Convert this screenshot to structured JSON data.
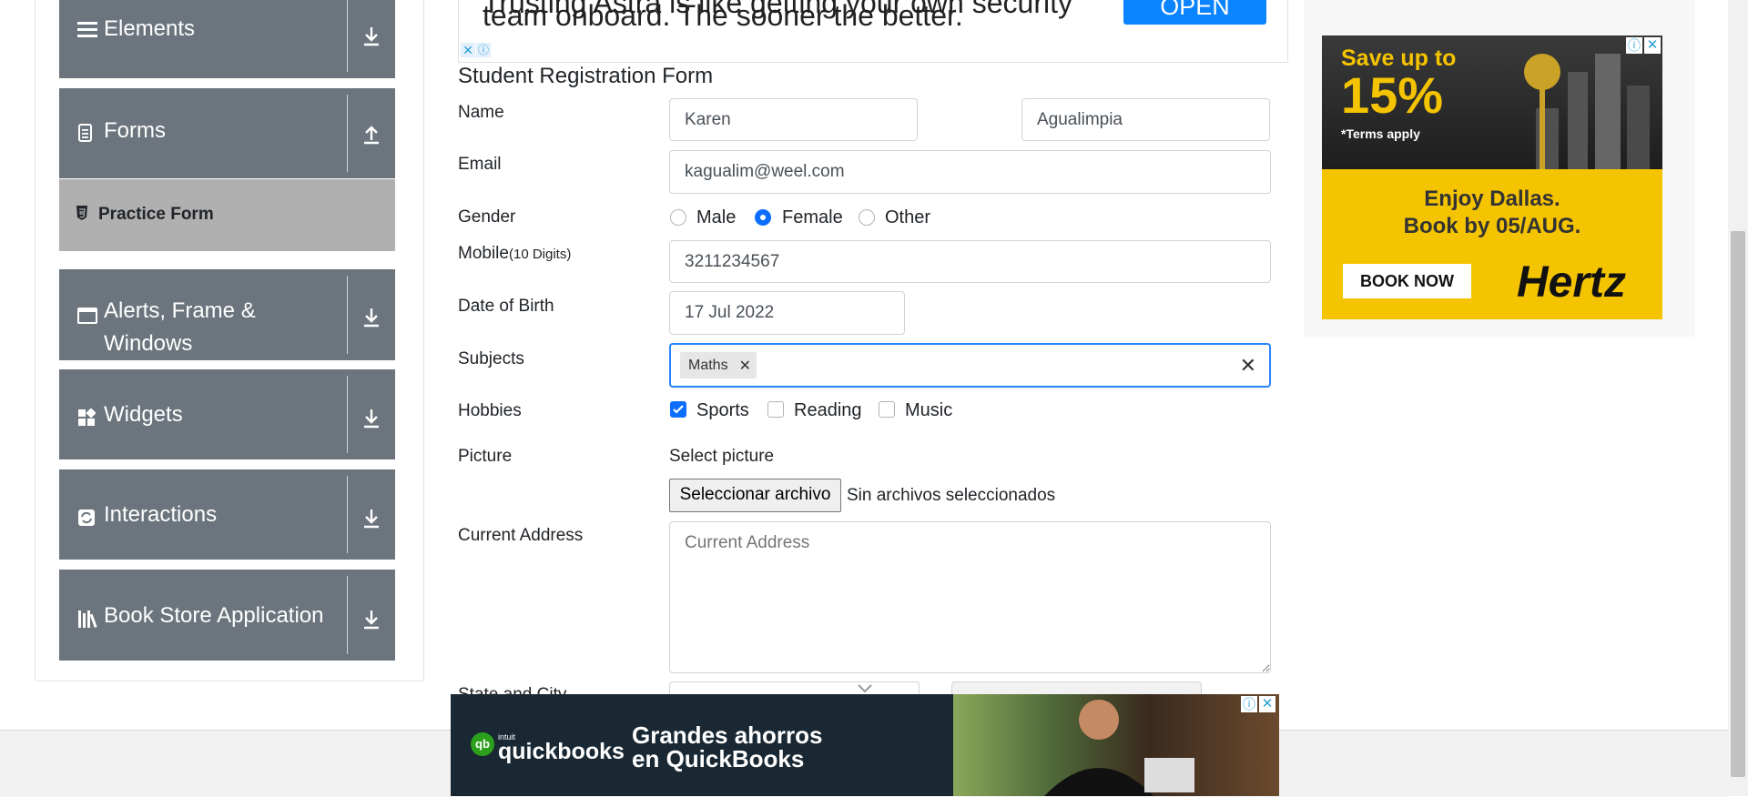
{
  "sidebar": {
    "groups": [
      {
        "label": "Elements",
        "icon": "menu-icon",
        "arrow": "download-arrow-icon"
      },
      {
        "label": "Forms",
        "icon": "document-icon",
        "arrow": "upload-arrow-icon"
      },
      {
        "label": "Alerts, Frame &",
        "label2": "Windows",
        "icon": "window-icon",
        "arrow": "download-arrow-icon"
      },
      {
        "label": "Widgets",
        "icon": "widgets-icon",
        "arrow": "download-arrow-icon"
      },
      {
        "label": "Interactions",
        "icon": "interactions-icon",
        "arrow": "download-arrow-icon"
      },
      {
        "label": "Book Store Application",
        "icon": "books-icon",
        "arrow": "download-arrow-icon"
      }
    ],
    "active_item": "Practice Form"
  },
  "ad_top": {
    "line1": "Trusting Astra is like getting your own security",
    "line2": "team onboard. The sooner the better.",
    "button": "OPEN"
  },
  "form": {
    "title": "Student Registration Form",
    "name_label": "Name",
    "first_name": "Karen",
    "last_name": "Agualimpia",
    "email_label": "Email",
    "email": "kagualim@weel.com",
    "gender_label": "Gender",
    "gender_options": [
      "Male",
      "Female",
      "Other"
    ],
    "gender_selected": "Female",
    "mobile_label": "Mobile",
    "mobile_hint": "(10 Digits)",
    "mobile": "3211234567",
    "dob_label": "Date of Birth",
    "dob": "17 Jul 2022",
    "subjects_label": "Subjects",
    "subject_chip": "Maths",
    "hobbies_label": "Hobbies",
    "hobbies": [
      "Sports",
      "Reading",
      "Music"
    ],
    "hobbies_checked": [
      "Sports"
    ],
    "picture_label": "Picture",
    "select_picture": "Select picture",
    "file_button": "Seleccionar archivo",
    "file_status": "Sin archivos seleccionados",
    "address_label": "Current Address",
    "address_placeholder": "Current Address",
    "state_label": "State and City"
  },
  "ad_right": {
    "headline": "Save up to",
    "percent": "15%",
    "terms": "*Terms apply",
    "line1": "Enjoy Dallas.",
    "line2": "Book by 05/AUG.",
    "button": "BOOK NOW",
    "brand": "Hertz"
  },
  "ad_bottom": {
    "logo_small": "intuit",
    "logo": "quickbooks",
    "line1": "Grandes ahorros",
    "line2": "en QuickBooks"
  },
  "colors": {
    "sidebar_bg": "#6c757d",
    "active_bg": "#b0b0b0",
    "primary": "#0d6efd",
    "ad_yellow": "#f5c400",
    "ad_open": "#0a84ff"
  }
}
